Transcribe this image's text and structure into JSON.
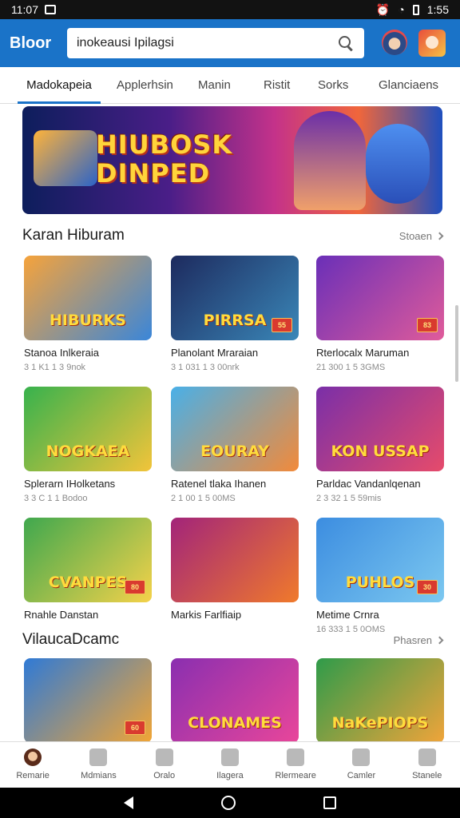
{
  "status_bar": {
    "time": "11:07",
    "battery": "1:55"
  },
  "app_bar": {
    "logo": "Bloor",
    "search": {
      "value": "inokeausi Ipilagsi",
      "placeholder": ""
    }
  },
  "tabs": [
    {
      "label": "Madokapeia",
      "active": true
    },
    {
      "label": "Applerhsin",
      "active": false
    },
    {
      "label": "Manin",
      "active": false
    },
    {
      "label": "Ristit",
      "active": false
    },
    {
      "label": "Sorks",
      "active": false
    },
    {
      "label": "Glanciaens",
      "active": false
    }
  ],
  "banner": {
    "title_line1": "HIUBOSK",
    "title_line2": "DINPED"
  },
  "section1": {
    "title": "Karan Hiburam",
    "more": "Stoaen"
  },
  "section2": {
    "title": "VilaucaDcamc",
    "more": "Phasren"
  },
  "cards": [
    {
      "title": "Stanoa Inlkeraia",
      "sub": "3 1 K1 1 3 9nok",
      "thumb_text": "HIBURKS",
      "badge": "",
      "colors": [
        "#f6a33b",
        "#3a86d9"
      ]
    },
    {
      "title": "Planolant Mraraian",
      "sub": "3 1 031 1 3 00nrk",
      "thumb_text": "PIRRSA",
      "badge": "55",
      "colors": [
        "#1d2a5e",
        "#3a87b8"
      ]
    },
    {
      "title": "Rterlocalx Maruman",
      "sub": "21 300 1 5 3GMS",
      "thumb_text": "",
      "badge": "83",
      "colors": [
        "#6a2fb8",
        "#e05b9a"
      ]
    },
    {
      "title": "Splerarn IHolketans",
      "sub": "3 3 C 1 1 Bodoo",
      "thumb_text": "NOGKAEA",
      "badge": "",
      "colors": [
        "#37b24d",
        "#f2c43a"
      ]
    },
    {
      "title": "Ratenel tlaka Ihanen",
      "sub": "2 1 00 1 5 00MS",
      "thumb_text": "EOURAY",
      "badge": "",
      "colors": [
        "#49b0e8",
        "#f28a3a"
      ]
    },
    {
      "title": "Parldac Vandanlqenan",
      "sub": "2 3 32 1 5 59mis",
      "thumb_text": "KON USSAP",
      "badge": "",
      "colors": [
        "#7a2fa8",
        "#e64b6b"
      ]
    },
    {
      "title": "Rnahle Danstan",
      "sub": "",
      "thumb_text": "CVANPES",
      "badge": "80",
      "colors": [
        "#3fa84e",
        "#f5d24a"
      ]
    },
    {
      "title": "Markis Farlfiaip",
      "sub": "",
      "thumb_text": "",
      "badge": "",
      "colors": [
        "#a2247a",
        "#f07a2b"
      ]
    },
    {
      "title": "Metime Crnra",
      "sub": "16 333 1 5 0OMS",
      "thumb_text": "PUHLOS",
      "badge": "30",
      "colors": [
        "#3c8de0",
        "#7cc8f0"
      ]
    },
    {
      "title": "",
      "sub": "",
      "thumb_text": "",
      "badge": "60",
      "colors": [
        "#2f7ad6",
        "#f2a534"
      ]
    },
    {
      "title": "",
      "sub": "",
      "thumb_text": "CLONAMES",
      "badge": "",
      "colors": [
        "#8a2fb0",
        "#e9469a"
      ]
    },
    {
      "title": "",
      "sub": "",
      "thumb_text": "NaKePIOPS",
      "badge": "",
      "colors": [
        "#2f9b4a",
        "#f0a43a"
      ]
    }
  ],
  "bottom_nav": [
    {
      "label": "Remarie",
      "icon": "avatar-icon",
      "active": true
    },
    {
      "label": "Mdmians",
      "icon": "chat-icon",
      "active": false
    },
    {
      "label": "Oralo",
      "icon": "location-icon",
      "active": false
    },
    {
      "label": "Ilagera",
      "icon": "edit-icon",
      "active": false
    },
    {
      "label": "Rlermeare",
      "icon": "tools-icon",
      "active": false
    },
    {
      "label": "Camler",
      "icon": "calendar-icon",
      "active": false
    },
    {
      "label": "Stanele",
      "icon": "person-icon",
      "active": false
    }
  ]
}
